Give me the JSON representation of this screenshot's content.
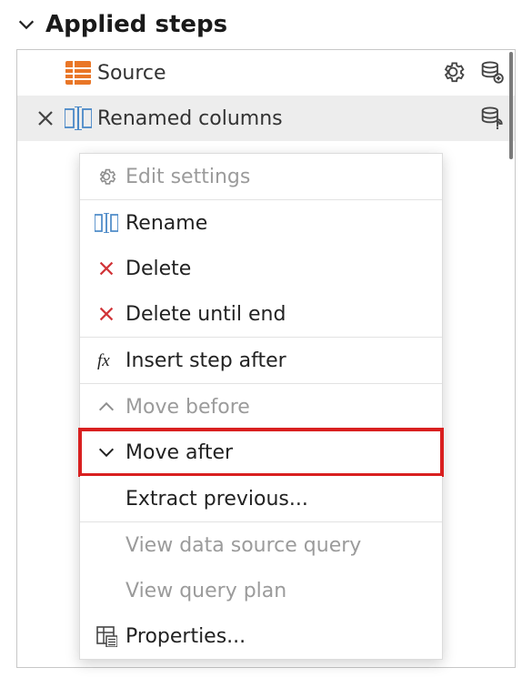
{
  "header": {
    "title": "Applied steps"
  },
  "steps": [
    {
      "name": "Source"
    },
    {
      "name": "Renamed columns"
    }
  ],
  "context_menu": {
    "edit_settings": "Edit settings",
    "rename": "Rename",
    "delete": "Delete",
    "delete_until_end": "Delete until end",
    "insert_step_after": "Insert step after",
    "move_before": "Move before",
    "move_after": "Move after",
    "extract_previous": "Extract previous...",
    "view_data_source_query": "View data source query",
    "view_query_plan": "View query plan",
    "properties": "Properties..."
  }
}
